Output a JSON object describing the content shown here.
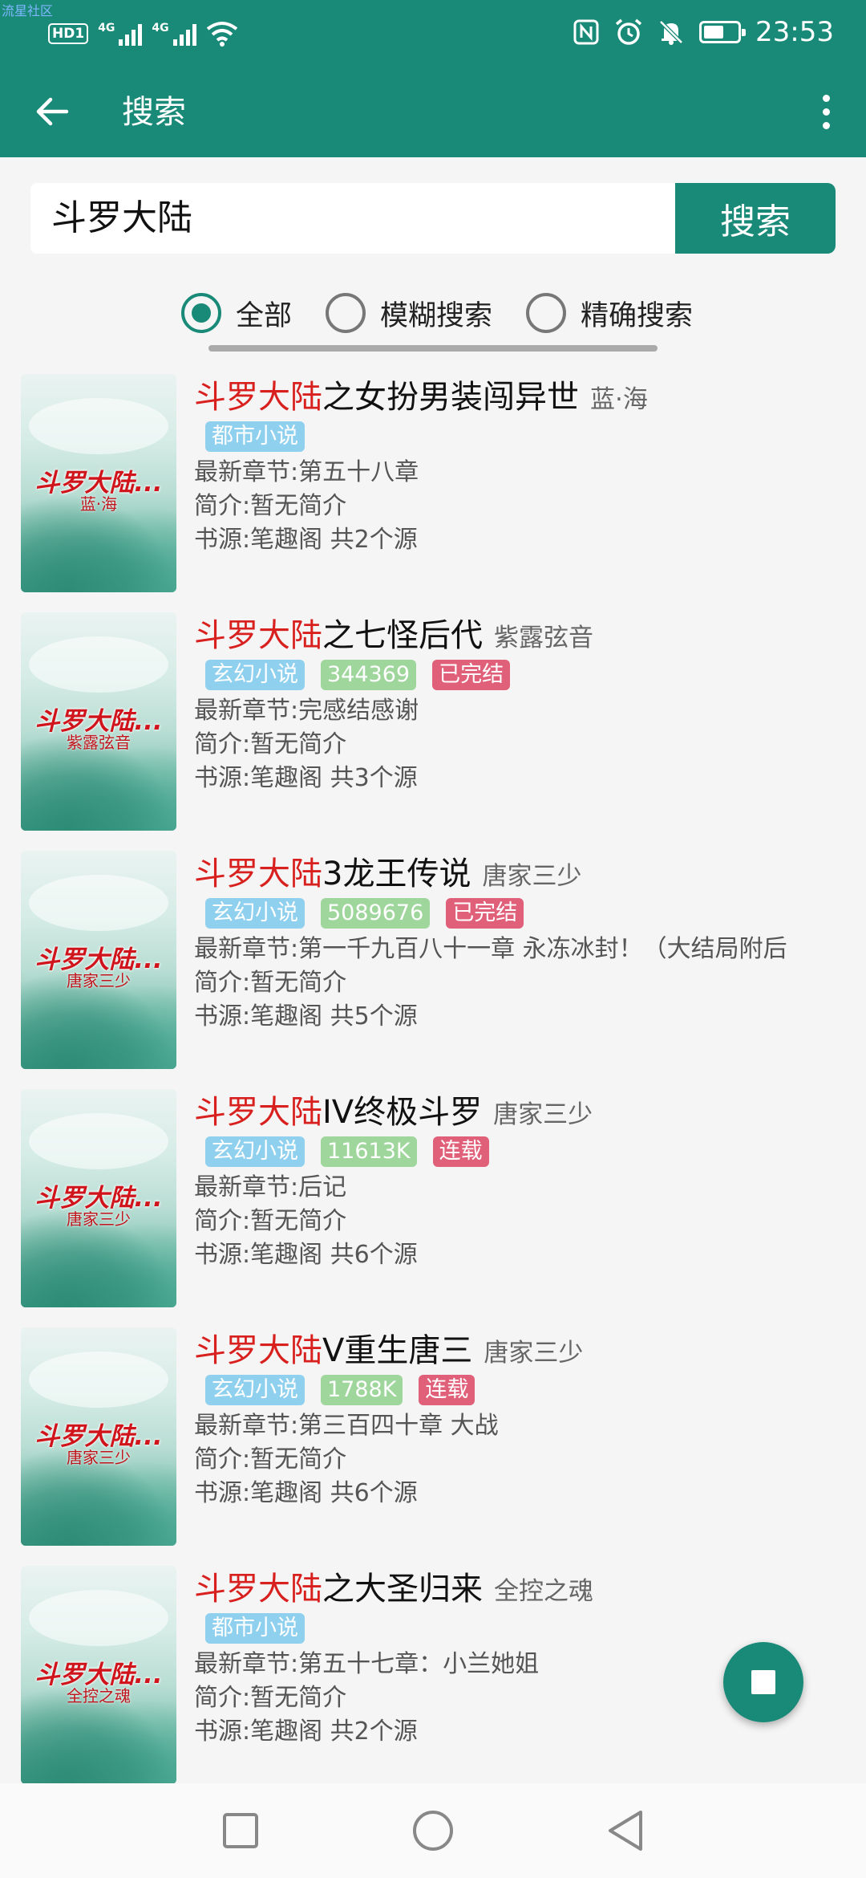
{
  "status_bar": {
    "watermark": "流星社区",
    "hd": "HD",
    "sim": "1",
    "net1": "4G",
    "net2": "4G",
    "time": "23:53",
    "icons": [
      "nfc-icon",
      "alarm-icon",
      "mute-icon",
      "battery-icon"
    ]
  },
  "app_bar": {
    "title": "搜索",
    "back_icon": "arrow-left-icon",
    "menu_icon": "more-vert-icon"
  },
  "search": {
    "query": "斗罗大陆",
    "button_label": "搜索"
  },
  "filters": [
    {
      "label": "全部",
      "checked": true
    },
    {
      "label": "模糊搜索",
      "checked": false
    },
    {
      "label": "精确搜索",
      "checked": false
    }
  ],
  "results": [
    {
      "title_highlight": "斗罗大陆",
      "title_rest": "之女扮男装闯异世",
      "author": "蓝·海",
      "cover_title": "斗罗大陆...",
      "cover_author": "蓝·海",
      "tags": [
        {
          "text": "都市小说",
          "kind": "cat"
        }
      ],
      "latest": "最新章节:第五十八章",
      "intro": "简介:暂无简介",
      "source": "书源:笔趣阁 共2个源"
    },
    {
      "title_highlight": "斗罗大陆",
      "title_rest": "之七怪后代",
      "author": "紫露弦音",
      "cover_title": "斗罗大陆...",
      "cover_author": "紫露弦音",
      "tags": [
        {
          "text": "玄幻小说",
          "kind": "cat"
        },
        {
          "text": "344369",
          "kind": "count"
        },
        {
          "text": "已完结",
          "kind": "done"
        }
      ],
      "latest": "最新章节:完感结感谢",
      "intro": "简介:暂无简介",
      "source": "书源:笔趣阁 共3个源"
    },
    {
      "title_highlight": "斗罗大陆",
      "title_rest": "3龙王传说",
      "author": "唐家三少",
      "cover_title": "斗罗大陆...",
      "cover_author": "唐家三少",
      "tags": [
        {
          "text": "玄幻小说",
          "kind": "cat"
        },
        {
          "text": "5089676",
          "kind": "count"
        },
        {
          "text": "已完结",
          "kind": "done"
        }
      ],
      "latest": "最新章节:第一千九百八十一章 永冻冰封！（大结局附后",
      "intro": "简介:暂无简介",
      "source": "书源:笔趣阁 共5个源"
    },
    {
      "title_highlight": "斗罗大陆",
      "title_rest": "IV终极斗罗",
      "author": "唐家三少",
      "cover_title": "斗罗大陆...",
      "cover_author": "唐家三少",
      "tags": [
        {
          "text": "玄幻小说",
          "kind": "cat"
        },
        {
          "text": "11613K",
          "kind": "count"
        },
        {
          "text": "连载",
          "kind": "done"
        }
      ],
      "latest": "最新章节:后记",
      "intro": "简介:暂无简介",
      "source": "书源:笔趣阁 共6个源"
    },
    {
      "title_highlight": "斗罗大陆",
      "title_rest": "V重生唐三",
      "author": "唐家三少",
      "cover_title": "斗罗大陆...",
      "cover_author": "唐家三少",
      "tags": [
        {
          "text": "玄幻小说",
          "kind": "cat"
        },
        {
          "text": "1788K",
          "kind": "count"
        },
        {
          "text": "连载",
          "kind": "done"
        }
      ],
      "latest": "最新章节:第三百四十章 大战",
      "intro": "简介:暂无简介",
      "source": "书源:笔趣阁 共6个源"
    },
    {
      "title_highlight": "斗罗大陆",
      "title_rest": "之大圣归来",
      "author": "全控之魂",
      "cover_title": "斗罗大陆...",
      "cover_author": "全控之魂",
      "tags": [
        {
          "text": "都市小说",
          "kind": "cat"
        }
      ],
      "latest": "最新章节:第五十七章：小兰她姐",
      "intro": "简介:暂无简介",
      "source": "书源:笔趣阁 共2个源"
    }
  ],
  "fab": {
    "icon": "stop-icon"
  },
  "nav_bar": {
    "icons": [
      "recents-icon",
      "home-icon",
      "back-icon"
    ]
  }
}
